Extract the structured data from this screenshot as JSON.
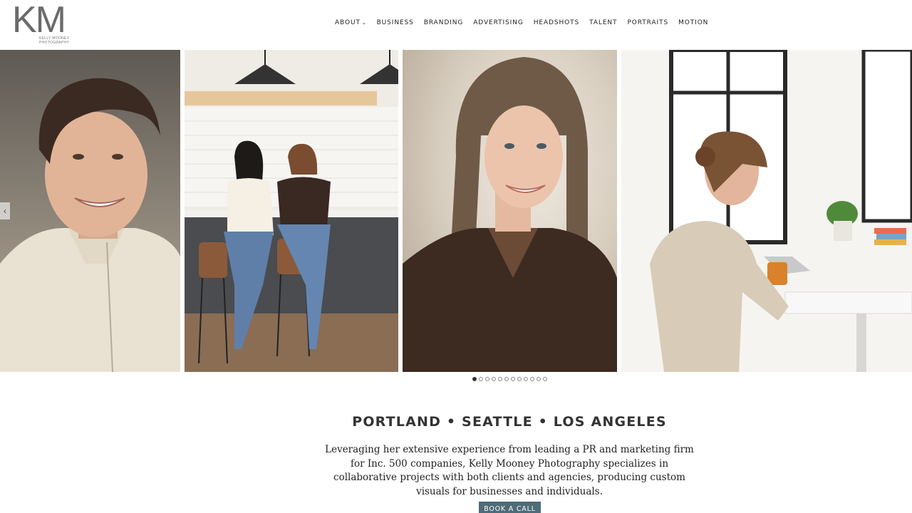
{
  "brand": {
    "logo_mark": "KM",
    "logo_line1": "KELLY MOONEY",
    "logo_line2": "PHOTOGRAPHY"
  },
  "nav": {
    "items": [
      "ABOUT",
      "BUSINESS",
      "BRANDING",
      "ADVERTISING",
      "HEADSHOTS",
      "TALENT",
      "PORTRAITS",
      "MOTION"
    ],
    "about_has_dropdown": true
  },
  "gallery": {
    "prev_icon": "chevron-left-icon",
    "prev_glyph": "‹",
    "dot_count": 12,
    "active_dot": 1
  },
  "main": {
    "heading": "PORTLAND • SEATTLE • LOS ANGELES",
    "intro": "Leveraging her extensive experience from leading a PR and marketing firm for Inc. 500 companies, Kelly Mooney Photography specializes in collaborative projects with both clients and agencies, producing custom visuals for businesses and individuals.",
    "cta_label": "BOOK A CALL"
  },
  "colors": {
    "cta_bg": "#4e6b78",
    "logo": "#6b6b6b"
  }
}
